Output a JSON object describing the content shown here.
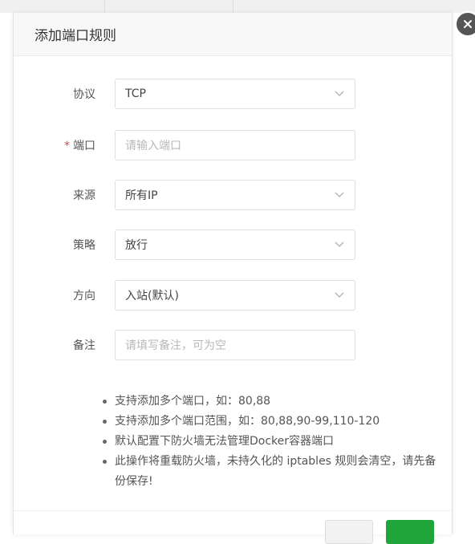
{
  "dialog": {
    "title": "添加端口规则",
    "close_icon": "close-icon"
  },
  "form": {
    "protocol": {
      "label": "协议",
      "value": "TCP"
    },
    "port": {
      "label": "端口",
      "required_mark": "*",
      "placeholder": "请输入端口"
    },
    "source": {
      "label": "来源",
      "value": "所有IP"
    },
    "strategy": {
      "label": "策略",
      "value": "放行"
    },
    "direction": {
      "label": "方向",
      "value": "入站(默认)"
    },
    "remark": {
      "label": "备注",
      "placeholder": "请填写备注，可为空"
    }
  },
  "tips": [
    "支持添加多个端口，如：80,88",
    "支持添加多个端口范围，如：80,88,90-99,110-120",
    "默认配置下防火墙无法管理Docker容器端口",
    "此操作将重载防火墙，未持久化的 iptables 规则会清空，请先备份保存!"
  ],
  "colors": {
    "required": "#e5484d",
    "confirm": "#20a53a"
  }
}
